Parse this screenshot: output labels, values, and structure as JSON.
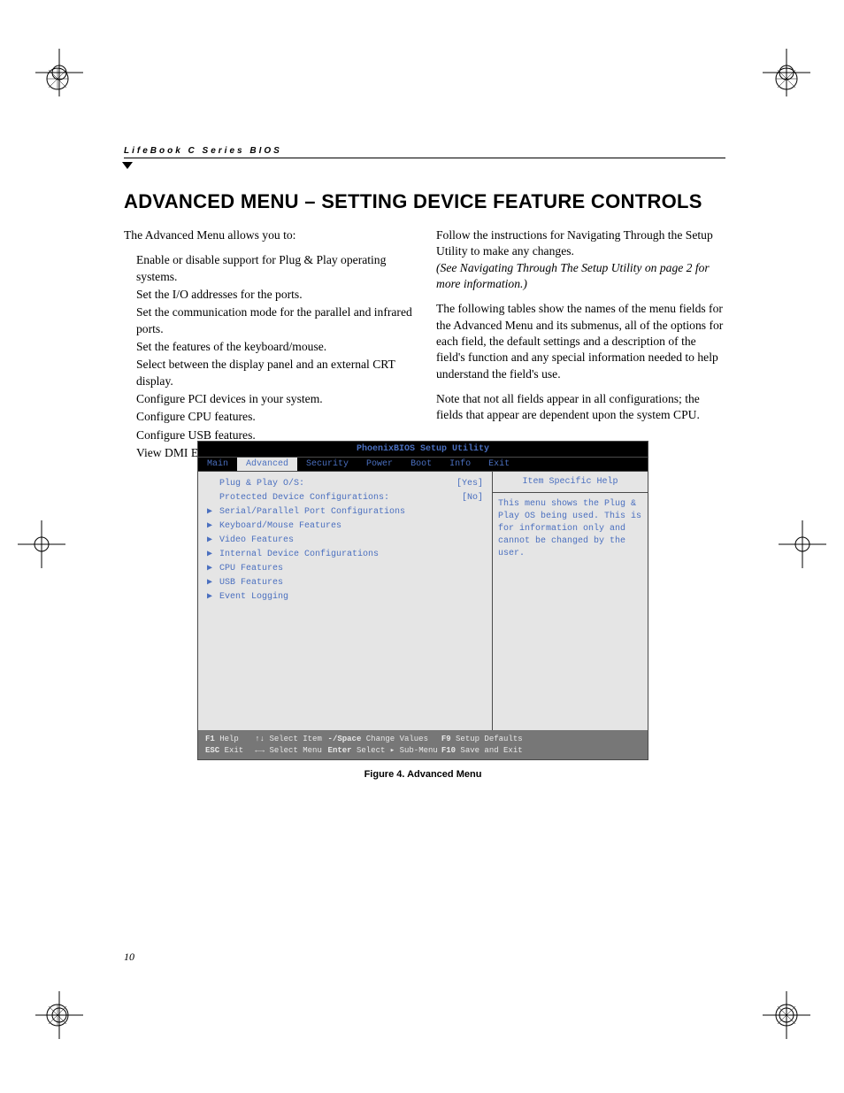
{
  "running_head": "LifeBook C Series BIOS",
  "title": "ADVANCED MENU – SETTING DEVICE FEATURE CONTROLS",
  "left_col": {
    "lede": "The Advanced Menu allows you to:",
    "bullets": [
      "Enable or disable support for Plug & Play operating systems.",
      "Set the I/O addresses for the ports.",
      "Set the communication mode for the parallel and infrared ports.",
      "Set the features of the keyboard/mouse.",
      "Select between the display panel and an external CRT display.",
      "Configure PCI devices in your system.",
      "Configure CPU features.",
      "Configure USB features.",
      "View DMI Event Logging"
    ]
  },
  "right_col": {
    "p1a": "Follow the instructions for Navigating Through the Setup Utility to make any changes.",
    "p1b": "(See Navigating Through The Setup Utility on page 2 for more information.)",
    "p2": "The following tables show the names of the menu fields for the Advanced Menu and its submenus, all of the options for each field, the default settings and a description of the field's function and any special information needed to help understand the field's use.",
    "p3": "Note that not all fields appear in all configurations; the fields that appear are dependent upon the system CPU."
  },
  "bios": {
    "title": "PhoenixBIOS Setup Utility",
    "tabs": [
      "Main",
      "Advanced",
      "Security",
      "Power",
      "Boot",
      "Info",
      "Exit"
    ],
    "active_tab": "Advanced",
    "help_title": "Item Specific Help",
    "help_body": "This menu shows the Plug & Play OS being used. This is for information only and cannot be changed by the user.",
    "menu_items": [
      {
        "caret": "",
        "label": "Plug & Play O/S:",
        "value": "[Yes]"
      },
      {
        "caret": "",
        "label": "Protected Device Configurations:",
        "value": "[No]"
      },
      {
        "caret": "▶",
        "label": "Serial/Parallel Port Configurations",
        "value": ""
      },
      {
        "caret": "▶",
        "label": "Keyboard/Mouse Features",
        "value": ""
      },
      {
        "caret": "▶",
        "label": "Video Features",
        "value": ""
      },
      {
        "caret": "▶",
        "label": "Internal Device Configurations",
        "value": ""
      },
      {
        "caret": "▶",
        "label": "CPU Features",
        "value": ""
      },
      {
        "caret": "▶",
        "label": "USB Features",
        "value": ""
      },
      {
        "caret": "▶",
        "label": "Event Logging",
        "value": ""
      }
    ],
    "footer": {
      "f1": "F1",
      "f1_label": "Help",
      "up": "↑↓",
      "up_label": "Select Item",
      "minus": "-/Space",
      "minus_label": "Change Values",
      "f9": "F9",
      "f9_label": "Setup Defaults",
      "esc": "ESC",
      "esc_label": "Exit",
      "lr": "←→",
      "lr_label": "Select Menu",
      "enter": "Enter",
      "enter_label": "Select ▸ Sub-Menu",
      "f10": "F10",
      "f10_label": "Save and Exit"
    }
  },
  "figure_caption": "Figure 4.  Advanced Menu",
  "page_number": "10"
}
